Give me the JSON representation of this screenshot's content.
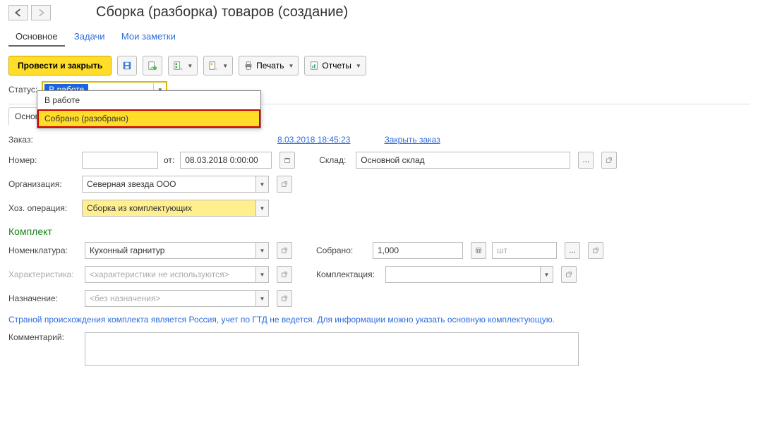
{
  "header": {
    "title": "Сборка (разборка) товаров (создание)"
  },
  "tabs": {
    "main": "Основное",
    "tasks": "Задачи",
    "notes": "Мои заметки"
  },
  "toolbar": {
    "post_close": "Провести и закрыть",
    "print": "Печать",
    "reports": "Отчеты"
  },
  "status": {
    "label": "Статус:",
    "value": "В работе",
    "options": {
      "opt1": "В работе",
      "opt2": "Собрано (разобрано)"
    }
  },
  "subtabs": {
    "main": "Основн"
  },
  "order": {
    "label": "Заказ:",
    "date_link": "8.03.2018 18:45:23",
    "close_link": "Закрыть заказ"
  },
  "docnum": {
    "label": "Номер:",
    "value": "",
    "from": "от:",
    "date": "08.03.2018  0:00:00",
    "warehouse_label": "Склад:",
    "warehouse_value": "Основной склад"
  },
  "org": {
    "label": "Организация:",
    "value": "Северная звезда ООО"
  },
  "oper": {
    "label": "Хоз. операция:",
    "value": "Сборка из комплектующих"
  },
  "kit": {
    "header": "Комплект",
    "nomen_label": "Номенклатура:",
    "nomen_value": "Кухонный гарнитур",
    "collected_label": "Собрано:",
    "collected_value": "1,000",
    "unit_placeholder": "шт",
    "char_label": "Характеристика:",
    "char_placeholder": "<характеристики не используются>",
    "complectation_label": "Комплектация:",
    "purpose_label": "Назначение:",
    "purpose_placeholder": "<без назначения>"
  },
  "info_text": "Страной происхождения комплекта является Россия, учет по ГТД не ведется. Для информации можно указать основную комплектующую.",
  "comment": {
    "label": "Комментарий:",
    "value": ""
  }
}
